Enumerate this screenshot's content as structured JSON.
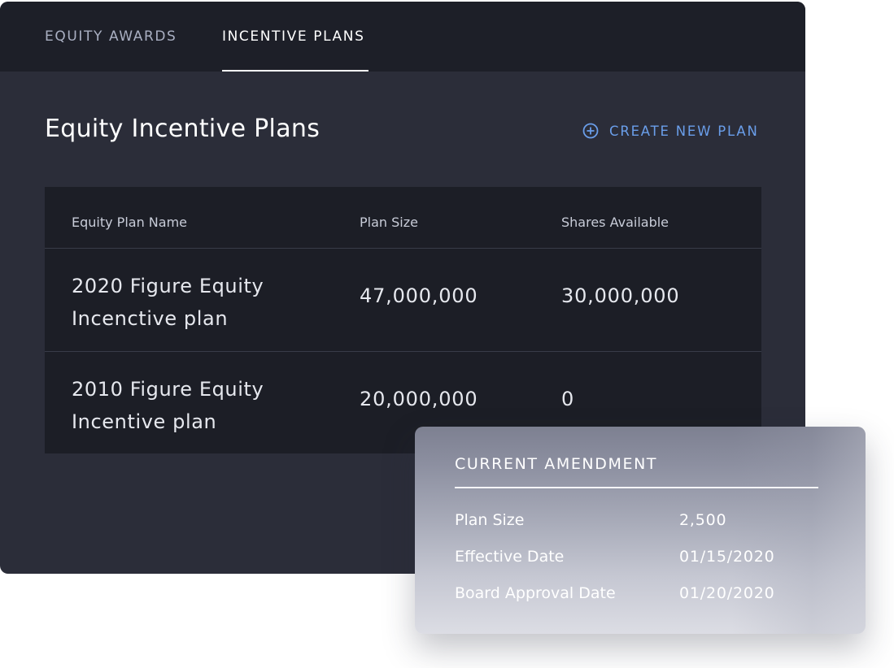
{
  "tabs": [
    {
      "label": "EQUITY AWARDS",
      "active": false
    },
    {
      "label": "INCENTIVE PLANS",
      "active": true
    }
  ],
  "header": {
    "title": "Equity Incentive Plans",
    "create_button": {
      "label": "CREATE NEW PLAN",
      "icon": "plus-circle-icon"
    }
  },
  "table": {
    "columns": [
      "Equity Plan Name",
      "Plan Size",
      "Shares Available"
    ],
    "rows": [
      {
        "name_line1": "2020 Figure Equity",
        "name_line2": "Incenctive plan",
        "plan_size": "47,000,000",
        "shares_available": "30,000,000"
      },
      {
        "name_line1": "2010 Figure Equity",
        "name_line2": "Incentive plan",
        "plan_size": "20,000,000",
        "shares_available": "0"
      }
    ]
  },
  "amendment": {
    "title": "CURRENT AMENDMENT",
    "fields": [
      {
        "label": "Plan Size",
        "value": "2,500"
      },
      {
        "label": "Effective Date",
        "value": "01/15/2020"
      },
      {
        "label": "Board Approval Date",
        "value": "01/20/2020"
      }
    ]
  },
  "colors": {
    "panel_bg": "#2b2d39",
    "tabbar_bg": "#1d1f28",
    "table_bg": "#1c1e26",
    "accent": "#6a9eea"
  }
}
